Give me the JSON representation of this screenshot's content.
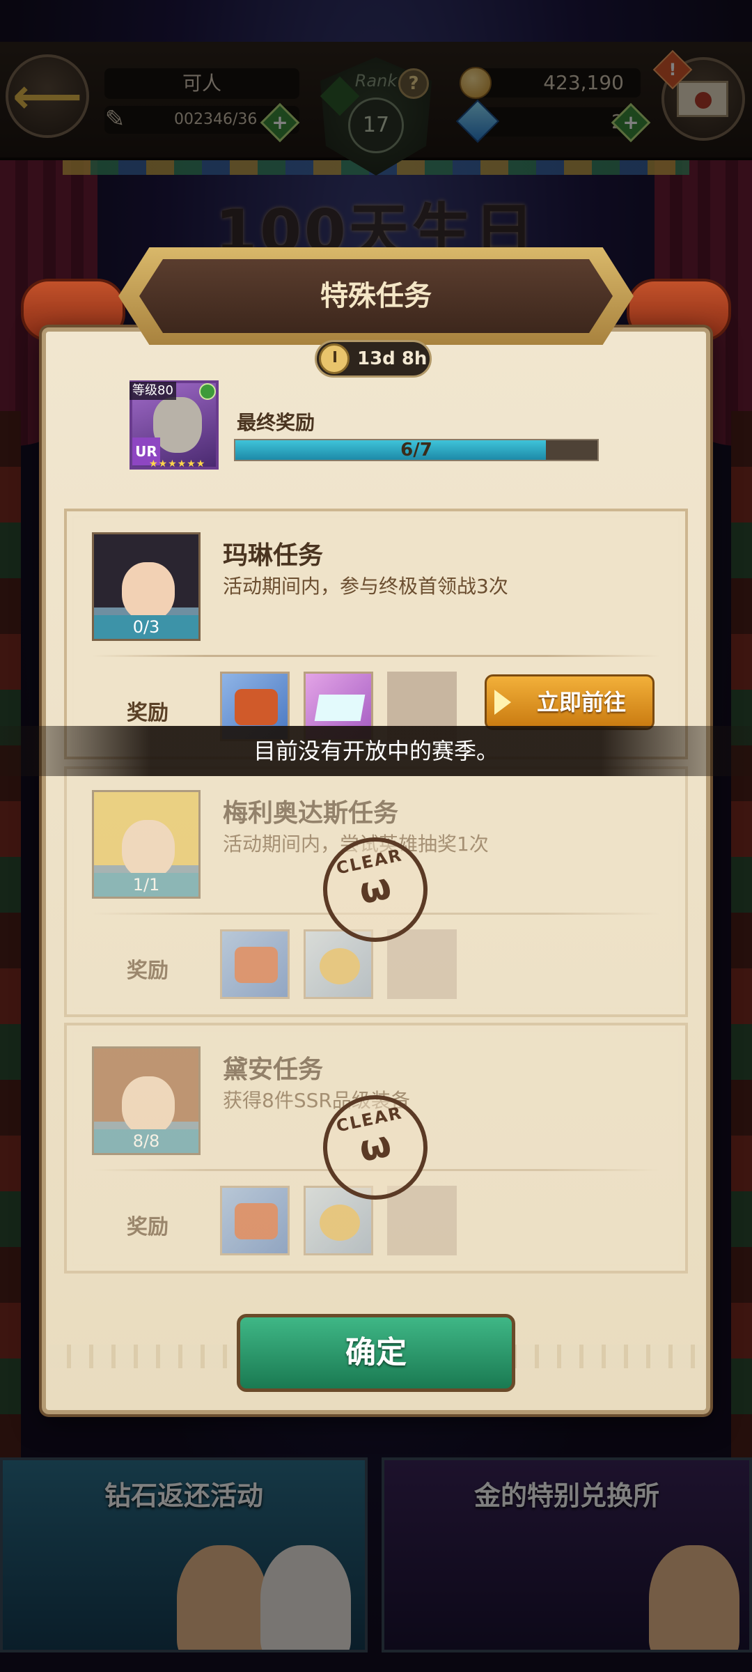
{
  "top_bar": {
    "player_name": "可人",
    "stamina": "002346/36",
    "rank_label": "Rank",
    "rank_value": "17",
    "gold": "423,190",
    "gems": "2",
    "alert_mark": "!",
    "help_mark": "?"
  },
  "background": {
    "banner_text": "100天生日"
  },
  "dialog": {
    "title": "特殊任务",
    "timer": "13d 8h",
    "final_reward": {
      "label": "最终奖励",
      "level_tag": "等级80",
      "rarity": "UR",
      "stars": "★★★★★★",
      "progress_text": "6/7",
      "progress_fraction": 0.857
    },
    "missions": [
      {
        "title": "玛琳任务",
        "description": "活动期间内，参与终极首领战3次",
        "count": "0/3",
        "reward_label": "奖励",
        "button_label": "立即前往"
      },
      {
        "title": "梅利奥达斯任务",
        "description": "活动期间内，尝试英雄抽奖1次",
        "count": "1/1",
        "reward_label": "奖励",
        "stamp_text": "CLEAR"
      },
      {
        "title": "黛安任务",
        "description": "获得8件SSR品级装备",
        "count": "8/8",
        "reward_label": "奖励",
        "stamp_text": "CLEAR"
      }
    ],
    "confirm_label": "确定"
  },
  "notice": {
    "text": "目前没有开放中的赛季。"
  },
  "bottom_banners": [
    {
      "label": "钻石返还活动"
    },
    {
      "label": "金的特别兑换所"
    }
  ],
  "colors": {
    "go_button": "#e19a22",
    "confirm_button": "#2a9a6a",
    "progress_fill": "#2ea4c0"
  }
}
